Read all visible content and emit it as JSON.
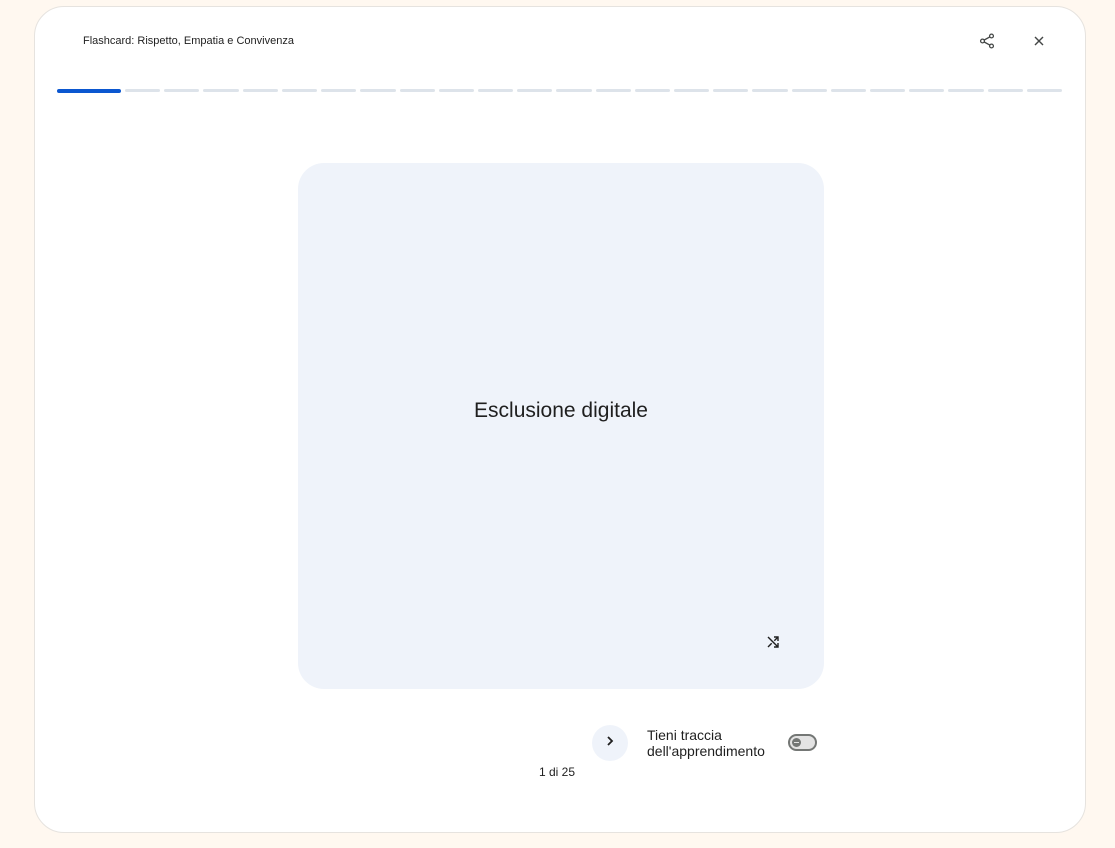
{
  "header": {
    "title": "Flashcard: Rispetto, Empatia e Convivenza",
    "share_icon": "share-icon",
    "close_icon": "close-icon"
  },
  "progress": {
    "total_cards": 25,
    "current_card": 1
  },
  "card": {
    "term": "Esclusione digitale",
    "shuffle_icon": "shuffle-icon"
  },
  "footer": {
    "counter": "1 di 25",
    "next_icon": "chevron-right-icon",
    "track_label_line1": "Tieni traccia",
    "track_label_line2": "dell'apprendimento",
    "track_enabled": false
  },
  "colors": {
    "accent": "#0b57d0",
    "card_bg": "#eff3fa",
    "progress_inactive": "#dde3ea",
    "page_bg": "#fff8f0"
  }
}
